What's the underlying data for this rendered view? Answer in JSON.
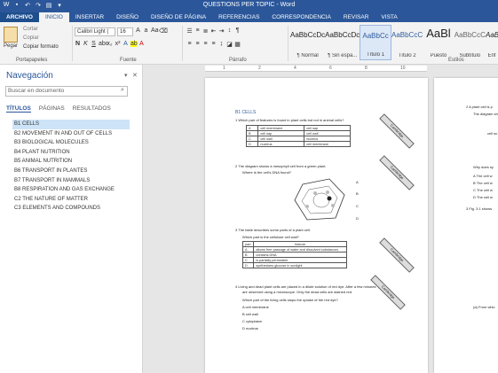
{
  "title_bar": {
    "document_title": "QUESTIONS PER TOPIC - Word",
    "qat_icons": [
      "word-icon",
      "save-icon",
      "undo-icon",
      "redo-icon",
      "print-icon",
      "customize-icon"
    ]
  },
  "ribbon_tabs": [
    "ARCHIVO",
    "INICIO",
    "INSERTAR",
    "DISEÑO",
    "DISEÑO DE PÁGINA",
    "REFERENCIAS",
    "CORRESPONDENCIA",
    "REVISAR",
    "VISTA"
  ],
  "active_tab": "INICIO",
  "clipboard": {
    "paste_label": "Pegar",
    "cut_label": "Cortar",
    "copy_label": "Copiar",
    "format_painter_label": "Copiar formato",
    "group_label": "Portapapeles"
  },
  "font_group": {
    "font_name": "Calibri Light (",
    "font_size": "16",
    "group_label": "Fuente"
  },
  "paragraph_group": {
    "group_label": "Párrafo"
  },
  "styles_group": {
    "group_label": "Estilos",
    "styles": [
      {
        "preview": "AaBbCcDc",
        "name": "¶ Normal"
      },
      {
        "preview": "AaBbCcDc",
        "name": "¶ Sin espa..."
      },
      {
        "preview": "AaBbCc",
        "name": "Título 1"
      },
      {
        "preview": "AaBbCcC",
        "name": "Título 2"
      },
      {
        "preview": "AaBl",
        "name": "Puesto"
      },
      {
        "preview": "AaBbCcC",
        "name": "Subtítulo"
      },
      {
        "preview": "AaBbCcDc",
        "name": "Énf"
      }
    ]
  },
  "navigation": {
    "title": "Navegación",
    "search_placeholder": "Buscar en documento",
    "tabs": [
      "TÍTULOS",
      "PÁGINAS",
      "RESULTADOS"
    ],
    "items": [
      "B1 CELLS",
      "B2 MOVEMENT IN AND OUT OF CELLS",
      "B3 BIOLOGICAL MOLECULES",
      "B4 PLANT NUTRITION",
      "B5 ANIMAL NUTRITION",
      "B6 TRANSPORT IN PLANTES",
      "B7 TRANSPORT IN MAMMALS",
      "B8 RESPIRATION AND GAS EXCHANGE",
      "C2 THE NATURE OF MATTER",
      "C3 ELEMENTS AND COMPOUNDS"
    ],
    "selected_index": 0
  },
  "page1": {
    "heading": "B1 CELLS",
    "q1": "1   Which pair of features is found in plant cells but not in animal cells?",
    "q1_rows": [
      [
        "A",
        "cell membrane",
        "cell sap"
      ],
      [
        "B",
        "cell sap",
        "cell wall"
      ],
      [
        "C",
        "cell wall",
        "nucleus"
      ],
      [
        "D",
        "nucleus",
        "cell membrane"
      ]
    ],
    "q2": "2   The diagram shows a mesophyll cell from a green plant.",
    "q2b": "Where is the cell's DNA found?",
    "q3": "3   The table describes some parts of a plant cell.",
    "q3b": "Which part is the cellulose cell wall?",
    "q3_header": [
      "part",
      "feature"
    ],
    "q3_rows": [
      [
        "A",
        "allows free passage of water and dissolved substances"
      ],
      [
        "B",
        "contains DNA"
      ],
      [
        "C",
        "is partially permeable"
      ],
      [
        "D",
        "synthesises glucose in sunlight"
      ]
    ],
    "q4": "4   Living and dead plant cells are placed in a dilute solution of red dye. After a few minutes",
    "q4b": "are observed using a microscope. Only the dead cells are stained red.",
    "q4c": "Which part of the living cells stops the uptake of the red dye?",
    "q4_options": [
      "A   cell membrane",
      "B   cell wall",
      "C   cytoplasm",
      "D   nucleus"
    ],
    "banner_text": "Cambridge"
  },
  "page2": {
    "lines": [
      "2   A plant cell is p",
      "The diagram sh",
      "cell su",
      "Why does sy",
      "A   The cell w",
      "B   The cell w",
      "C   The cell w",
      "D   The cell w",
      "3   Fig. 3.1 shows",
      "(a)   From whic"
    ]
  }
}
